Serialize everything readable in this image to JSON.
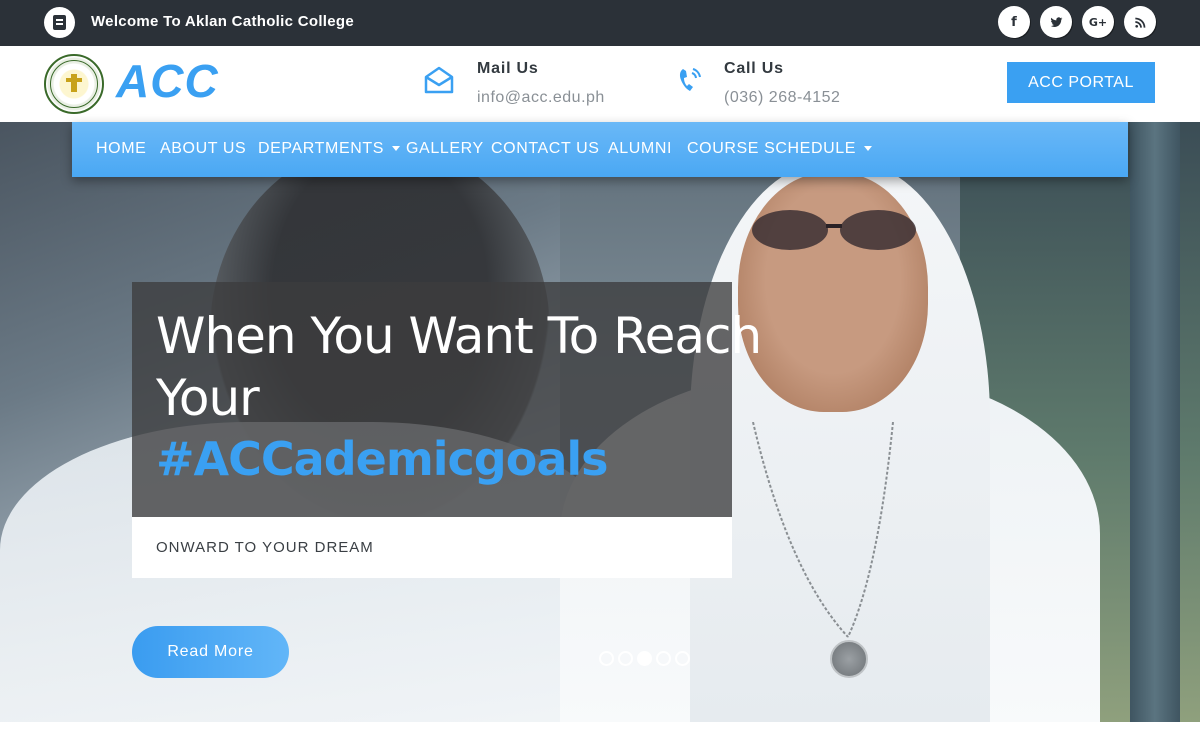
{
  "topbar": {
    "welcome": "Welcome To Aklan Catholic College",
    "social": [
      {
        "icon": "facebook-icon",
        "glyph": "f"
      },
      {
        "icon": "twitter-icon",
        "glyph": ""
      },
      {
        "icon": "google-plus-icon",
        "glyph": "G+"
      },
      {
        "icon": "rss-icon",
        "glyph": ""
      }
    ]
  },
  "header": {
    "seal_text": "AKLAN CATHOLIC COLLEGE",
    "brand": "ACC",
    "mail": {
      "title": "Mail Us",
      "value": "info@acc.edu.ph"
    },
    "call": {
      "title": "Call Us",
      "value": "(036) 268-4152"
    },
    "portal_label": "ACC PORTAL"
  },
  "nav": {
    "items": [
      {
        "label": "HOME",
        "dropdown": false
      },
      {
        "label": "ABOUT US",
        "dropdown": false
      },
      {
        "label": "DEPARTMENTS",
        "dropdown": true
      },
      {
        "label": "GALLERY",
        "dropdown": false
      },
      {
        "label": "CONTACT US",
        "dropdown": false
      },
      {
        "label": "ALUMNI",
        "dropdown": false
      },
      {
        "label": "COURSE SCHEDULE",
        "dropdown": true
      }
    ]
  },
  "hero": {
    "line1": "When You Want To Reach",
    "line2": "Your",
    "hashtag": "#ACCademicgoals",
    "subtitle": "ONWARD TO YOUR DREAM",
    "read_more": "Read More",
    "slides_total": 5,
    "slide_active": 3
  },
  "colors": {
    "accent": "#3aa0f2",
    "topbar": "#2b3138"
  }
}
